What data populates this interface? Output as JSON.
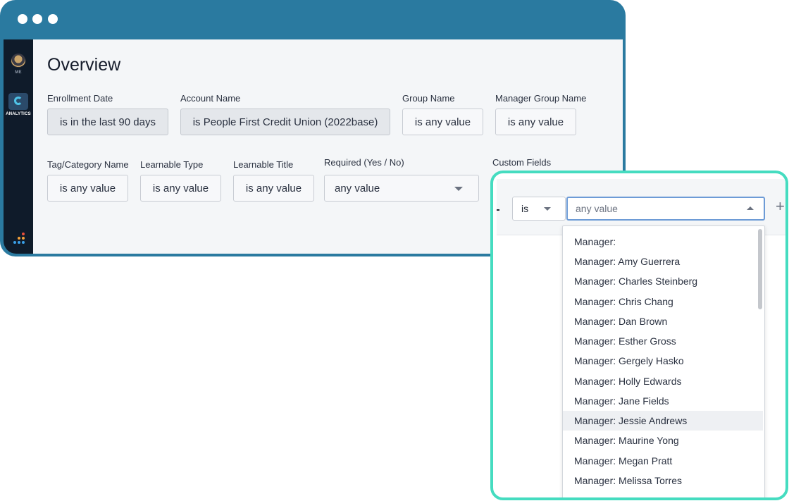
{
  "sidebar": {
    "me_label": "ME",
    "analytics_label": "ANALYTICS"
  },
  "page": {
    "title": "Overview"
  },
  "filters": [
    {
      "label": "Enrollment Date",
      "value": "is in the last 90 days"
    },
    {
      "label": "Account Name",
      "value": "is People First Credit Union (2022base)"
    },
    {
      "label": "Group Name",
      "value": "is any value"
    },
    {
      "label": "Manager Group Name",
      "value": "is any value"
    },
    {
      "label": "Tag/Category Name",
      "value": "is any value"
    },
    {
      "label": "Learnable Type",
      "value": "is any value"
    },
    {
      "label": "Learnable Title",
      "value": "is any value"
    },
    {
      "label": "Required (Yes / No)",
      "value": "any value"
    },
    {
      "label": "Custom Fields",
      "value": ""
    }
  ],
  "custom_field": {
    "operator": "is",
    "value_placeholder": "any value",
    "add_symbol": "+",
    "options": [
      "Manager:",
      "Manager: Amy Guerrera",
      "Manager: Charles Steinberg",
      "Manager: Chris Chang",
      "Manager: Dan Brown",
      "Manager: Esther Gross",
      "Manager: Gergely Hasko",
      "Manager: Holly Edwards",
      "Manager: Jane Fields",
      "Manager: Jessie Andrews",
      "Manager: Maurine Yong",
      "Manager: Megan Pratt",
      "Manager: Melissa Torres"
    ],
    "hovered_option": "Manager: Jessie Andrews"
  },
  "colors": {
    "window_frame": "#2a7aa0",
    "sidebar": "#0f1b2a",
    "highlight_border": "#45dcc0",
    "input_focus": "#6d9bd6"
  }
}
